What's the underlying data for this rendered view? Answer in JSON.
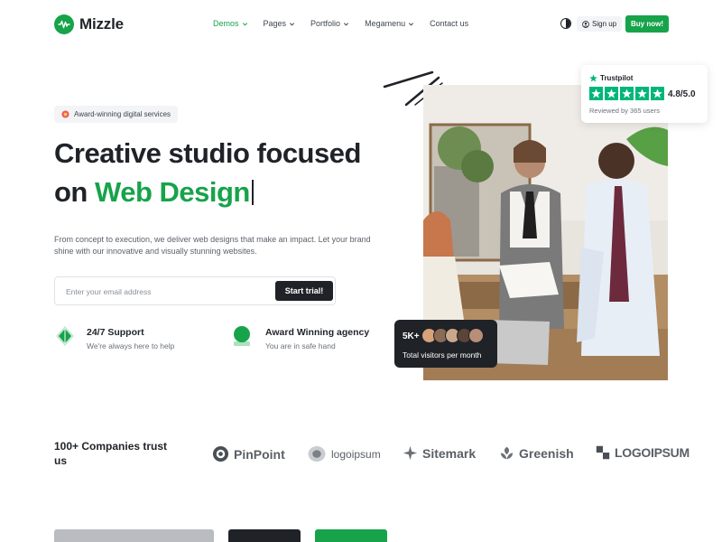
{
  "header": {
    "brand": "Mizzle",
    "nav": [
      {
        "label": "Demos",
        "dropdown": true
      },
      {
        "label": "Pages",
        "dropdown": true
      },
      {
        "label": "Portfolio",
        "dropdown": true
      },
      {
        "label": "Megamenu",
        "dropdown": true
      },
      {
        "label": "Contact us",
        "dropdown": false
      }
    ],
    "signup_label": "Sign up",
    "buy_label": "Buy now!"
  },
  "hero": {
    "badge": "Award-winning digital services",
    "heading_line1": "Creative studio focused",
    "heading_line2_prefix": "on ",
    "heading_line2_highlight": "Web Design",
    "description": "From concept to execution, we deliver web designs that make an impact. Let your brand shine with our innovative and visually stunning websites.",
    "email_placeholder": "Enter your email address",
    "cta_label": "Start trial!",
    "features": [
      {
        "title": "24/7 Support",
        "subtitle": "We're always here to help"
      },
      {
        "title": "Award Winning agency",
        "subtitle": "You are in safe hand"
      }
    ]
  },
  "trustpilot": {
    "brand": "Trustpilot",
    "score": "4.8/5.0",
    "stars": 5,
    "reviewed": "Reviewed by 365 users"
  },
  "visitors": {
    "count": "5K+",
    "label": "Total visitors per month"
  },
  "companies": {
    "title": "100+ Companies trust us",
    "brands": [
      "PinPoint",
      "logoipsum",
      "Sitemark",
      "Greenish",
      "LOGOIPSUM"
    ]
  },
  "colors": {
    "accent": "#17a34a",
    "dark": "#1f2328",
    "trustpilot": "#00b67a"
  }
}
